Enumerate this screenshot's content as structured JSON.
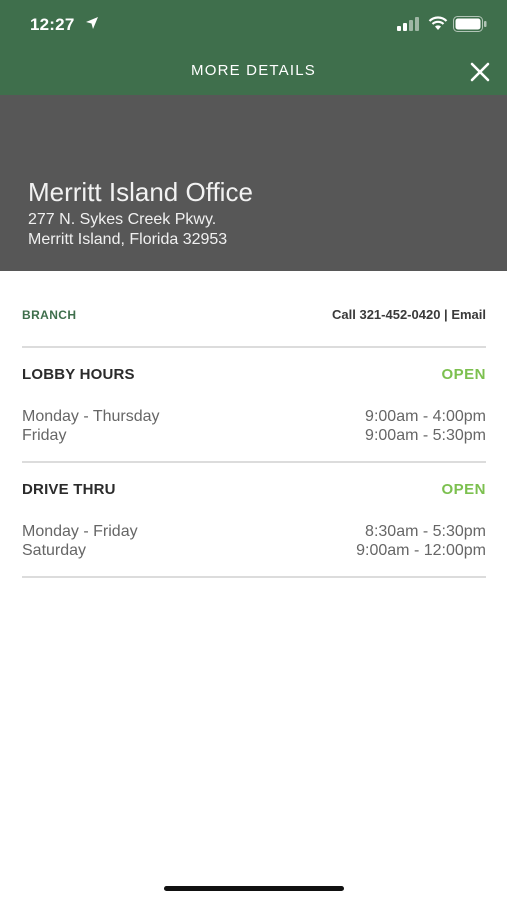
{
  "status_bar": {
    "time": "12:27",
    "icons": [
      "location-arrow-icon",
      "signal-icon",
      "wifi-icon",
      "battery-icon"
    ]
  },
  "header": {
    "title": "MORE DETAILS",
    "close_icon": "close-icon",
    "color": "#3f6f4c"
  },
  "office": {
    "name": "Merritt Island Office",
    "address_line1": "277 N. Sykes Creek Pkwy.",
    "address_line2": "Merritt Island, Florida 32953",
    "banner_color": "#575757"
  },
  "branch": {
    "label": "BRANCH",
    "call_text": "Call 321-452-0420",
    "separator": " | ",
    "email_text": "Email"
  },
  "lobby": {
    "title": "LOBBY HOURS",
    "status": "OPEN",
    "rows": [
      {
        "day": "Monday - Thursday",
        "hours": "9:00am - 4:00pm"
      },
      {
        "day": "Friday",
        "hours": "9:00am - 5:30pm"
      }
    ]
  },
  "drive_thru": {
    "title": "DRIVE THRU",
    "status": "OPEN",
    "rows": [
      {
        "day": "Monday - Friday",
        "hours": "8:30am - 5:30pm"
      },
      {
        "day": "Saturday",
        "hours": "9:00am - 12:00pm"
      }
    ]
  },
  "colors": {
    "open": "#7cc04f",
    "accent": "#3f6f4c"
  }
}
